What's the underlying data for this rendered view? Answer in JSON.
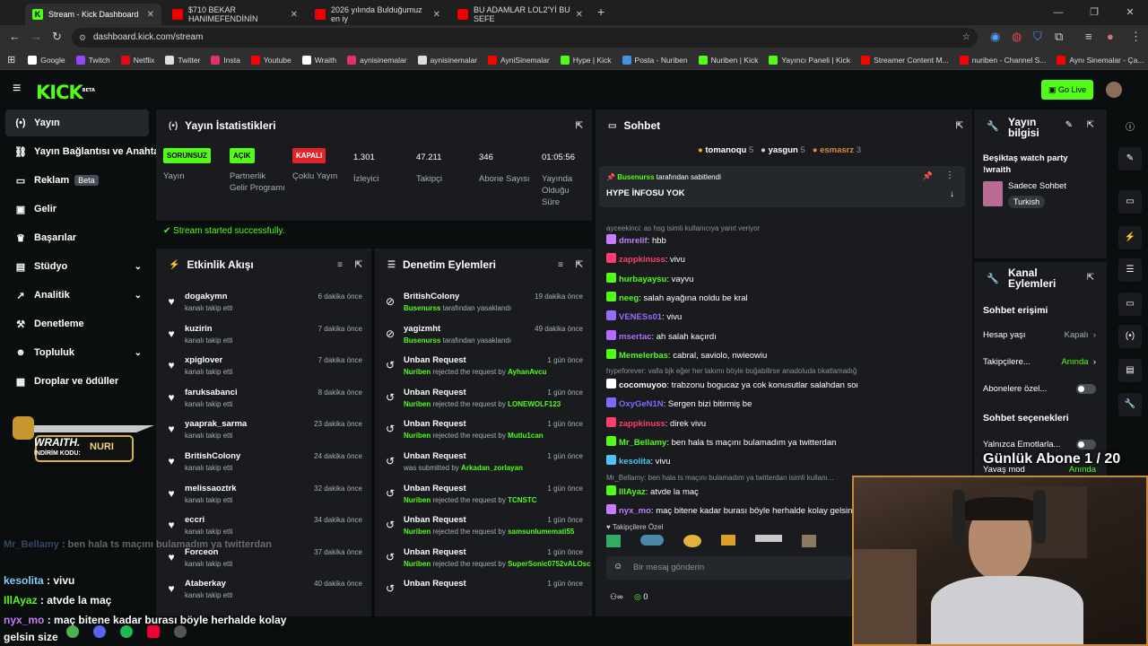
{
  "browser": {
    "tabs": [
      {
        "title": "Stream - Kick Dashboard",
        "kind": "kick",
        "active": true
      },
      {
        "title": "$710 BEKAR HANIMEFENDİNİN",
        "kind": "yt"
      },
      {
        "title": "2026 yılında Bulduğumuz en iy",
        "kind": "yt"
      },
      {
        "title": "BU ADAMLAR LOL2'Yİ BU SEFE",
        "kind": "yt"
      }
    ],
    "url": "dashboard.kick.com/stream",
    "bookmarks": [
      "Google",
      "Twitch",
      "Netflix",
      "Twitter",
      "Insta",
      "Youtube",
      "Wraith",
      "aynisinemalar",
      "aynisinemalar",
      "AyniSinemalar",
      "Hype | Kick",
      "Posta - Nuriben",
      "Nuriben | Kick",
      "Yayıncı Paneli | Kick",
      "Streamer Content M...",
      "nuriben - Channel S...",
      "Aynı Sinemalar - Ça..."
    ]
  },
  "header": {
    "logo": "KICK",
    "logo_sup": "BETA",
    "go_live": "Go Live"
  },
  "sidebar": {
    "items": [
      {
        "label": "Yayın",
        "icon": "broadcast-icon"
      },
      {
        "label": "Yayın Bağlantısı ve Anahtarı",
        "icon": "link-icon"
      },
      {
        "label": "Reklam",
        "icon": "ad-icon",
        "badge": "Beta"
      },
      {
        "label": "Gelir",
        "icon": "wallet-icon"
      },
      {
        "label": "Başarılar",
        "icon": "trophy-icon"
      },
      {
        "label": "Stüdyo",
        "icon": "studio-icon",
        "chevron": true
      },
      {
        "label": "Analitik",
        "icon": "analytics-icon",
        "chevron": true
      },
      {
        "label": "Denetleme",
        "icon": "hammer-icon"
      },
      {
        "label": "Topluluk",
        "icon": "community-icon",
        "chevron": true
      },
      {
        "label": "Droplar ve ödüller",
        "icon": "gift-icon"
      }
    ],
    "promo_name": "WRAITH.",
    "promo_code_label": "İNDİRİM KODU:",
    "promo_code": "NURI"
  },
  "stats": {
    "title": "Yayın İstatistikleri",
    "items": [
      {
        "pill": "SORUNSUZ",
        "pill_color": "#53fc18",
        "label": "Yayın"
      },
      {
        "pill": "AÇIK",
        "pill_color": "#53fc18",
        "label": "Partnerlik Gelir Programı"
      },
      {
        "pill": "KAPALI",
        "pill_color": "#e0262a",
        "label": "Çoklu Yayın"
      },
      {
        "value": "1.301",
        "label": "İzleyici"
      },
      {
        "value": "47.211",
        "label": "Takipçi"
      },
      {
        "value": "346",
        "label": "Abone Sayısı"
      },
      {
        "value": "01:05:56",
        "label": "Yayında Olduğu Süre"
      }
    ],
    "success": "Stream started successfully."
  },
  "activity": {
    "title": "Etkinlik Akışı",
    "rows": [
      {
        "name": "dogakymn",
        "sub": "kanalı takip etti",
        "time": "6 dakika önce"
      },
      {
        "name": "kuzirin",
        "sub": "kanalı takip etti",
        "time": "7 dakika önce"
      },
      {
        "name": "xpiglover",
        "sub": "kanalı takip etti",
        "time": "7 dakika önce"
      },
      {
        "name": "faruksabanci",
        "sub": "kanalı takip etti",
        "time": "8 dakika önce"
      },
      {
        "name": "yaaprak_sarma",
        "sub": "kanalı takip etti",
        "time": "23 dakika önce"
      },
      {
        "name": "BritishColony",
        "sub": "kanalı takip etti",
        "time": "24 dakika önce"
      },
      {
        "name": "melissaoztrk",
        "sub": "kanalı takip etti",
        "time": "32 dakika önce"
      },
      {
        "name": "eccri",
        "sub": "kanalı takip etti",
        "time": "34 dakika önce"
      },
      {
        "name": "Forceon",
        "sub": "kanalı takip etti",
        "time": "37 dakika önce"
      },
      {
        "name": "Ataberkay",
        "sub": "kanalı takip etti",
        "time": "40 dakika önce"
      }
    ]
  },
  "moderation": {
    "title": "Denetim Eylemleri",
    "rows": [
      {
        "title": "BritishColony",
        "actor": "Busenurss",
        "text": "tarafından yasaklandı",
        "target": "",
        "time": "19 dakika önce",
        "icon": "ban-icon"
      },
      {
        "title": "yagizmht",
        "actor": "Busenurss",
        "text": "tarafından yasaklandı",
        "target": "",
        "time": "49 dakika önce",
        "icon": "ban-icon"
      },
      {
        "title": "Unban Request",
        "actor": "Nuriben",
        "text": "rejected the request by",
        "target": "AyhanAvcu",
        "time": "1 gün önce",
        "icon": "history-icon"
      },
      {
        "title": "Unban Request",
        "actor": "Nuriben",
        "text": "rejected the request by",
        "target": "LONEWOLF123",
        "time": "1 gün önce",
        "icon": "history-icon"
      },
      {
        "title": "Unban Request",
        "actor": "Nuriben",
        "text": "rejected the request by",
        "target": "Mutlu1can",
        "time": "1 gün önce",
        "icon": "history-icon"
      },
      {
        "title": "Unban Request",
        "actor": "",
        "text": "was submitted by",
        "target": "Arkadan_zorlayan",
        "time": "1 gün önce",
        "icon": "history-icon"
      },
      {
        "title": "Unban Request",
        "actor": "Nuriben",
        "text": "rejected the request by",
        "target": "TCNSTC",
        "time": "1 gün önce",
        "icon": "history-icon"
      },
      {
        "title": "Unban Request",
        "actor": "Nuriben",
        "text": "rejected the request by",
        "target": "samsunlumemati55",
        "time": "1 gün önce",
        "icon": "history-icon"
      },
      {
        "title": "Unban Request",
        "actor": "Nuriben",
        "text": "rejected the request by",
        "target": "SuperSonic0752vALOsc",
        "time": "1 gün önce",
        "icon": "history-icon"
      },
      {
        "title": "Unban Request",
        "actor": "",
        "text": "",
        "target": "",
        "time": "1 gün önce",
        "icon": "history-icon"
      }
    ]
  },
  "chat": {
    "title": "Sohbet",
    "top_gifters": [
      {
        "name": "tomanoqu",
        "count": "5",
        "color": "#f5b400"
      },
      {
        "name": "yasgun",
        "count": "5",
        "color": "#cfd3d8"
      },
      {
        "name": "esmasrz",
        "count": "3",
        "color": "#d98b3a"
      }
    ],
    "pinned_by": "Busenurss",
    "pinned_label": "tarafından sabitlendi",
    "pinned_text": "HYPE İNFOSU YOK",
    "reply_note": "ayceekinci: as hsg isimli kullanıcıya yanıt veriyor",
    "messages": [
      {
        "user": "dmrelif",
        "color": "#c77dff",
        "text": "hbb"
      },
      {
        "user": "zappkinuss",
        "color": "#ff3e6c",
        "text": "vivu"
      },
      {
        "user": "hurbayaysu",
        "color": "#53fc18",
        "text": "vayvu"
      },
      {
        "user": "neeg",
        "color": "#53fc18",
        "text": "salah ayağına noldu be kral"
      },
      {
        "user": "VENESs01",
        "color": "#9b6bff",
        "text": "vivu"
      },
      {
        "user": "msertac",
        "color": "#b46bff",
        "text": "ah salah kaçırdı"
      },
      {
        "user": "Memelerbas",
        "color": "#53fc18",
        "text": "cabral, saviolo, nwieowiu"
      },
      {
        "user": "cocomuyoo",
        "color": "#fff",
        "text": "trabzonu bogucaz ya cok konusutlar salahdan sona",
        "reply": "hypeforever: valla bjk eğer her takımı böyle boğabilirse anadoluda tıkatlamadığı takım kalmaz isimli..."
      },
      {
        "user": "OxyGeN1N",
        "color": "#7c6bff",
        "text": "Sergen bizi bitirmiş be"
      },
      {
        "user": "zappkinuss",
        "color": "#ff3e6c",
        "text": "direk vivu"
      },
      {
        "user": "Mr_Bellamy",
        "color": "#53fc18",
        "text": "ben hala ts maçını bulamadım ya twitterdan"
      },
      {
        "user": "kesolita",
        "color": "#4fc3f7",
        "text": "vivu"
      },
      {
        "user": "IllAyaz",
        "color": "#53fc18",
        "text": "atvde la maç",
        "reply": "Mr_Bellamy: ben hala ts maçını bulamadım ya twitterdan isimli kullanı..."
      },
      {
        "user": "nyx_mo",
        "color": "#c77dff",
        "text": "maç bitene kadar burası böyle herhalde kolay gelsin"
      }
    ],
    "followers_special": "Takipçilere Özel",
    "input_placeholder": "Bir mesaj gönderin",
    "points": "0"
  },
  "stream_info": {
    "title": "Yayın bilgisi",
    "stream_title": "Beşiktaş watch party !wraith",
    "category": "Sadece Sohbet",
    "language": "Turkish"
  },
  "channel_actions": {
    "title": "Kanal Eylemleri",
    "chat_access": "Sohbet erişimi",
    "rows": [
      {
        "label": "Hesap yaşı",
        "value": "Kapalı",
        "value_color": "#a8aeb6"
      },
      {
        "label": "Takipçilere...",
        "value": "Anında",
        "value_color": "#53fc18"
      },
      {
        "label": "Abonelere özel...",
        "value": "",
        "toggle": true
      }
    ],
    "chat_options": "Sohbet seçenekleri",
    "emote_only": "Yalnızca Emotlarla...",
    "slow_mode": "Yavaş mod",
    "slow_value": "Anında"
  },
  "overlay": {
    "sub_goal": "Günlük Abone 1 / 20",
    "chat_lines": [
      {
        "user": "Mr_Bellamy",
        "color": "#7fb3ff",
        "text": "ben hala ts maçını bulamadım ya twitterdan",
        "dim": true
      },
      {
        "user": "kesolita",
        "color": "#7fd0ff",
        "text": "vivu"
      },
      {
        "user": "IllAyaz",
        "color": "#53fc18",
        "text": "atvde la maç"
      },
      {
        "user": "nyx_mo",
        "color": "#c77dff",
        "text": "maç bitene kadar burası böyle herhalde kolay gelsin size"
      }
    ]
  }
}
